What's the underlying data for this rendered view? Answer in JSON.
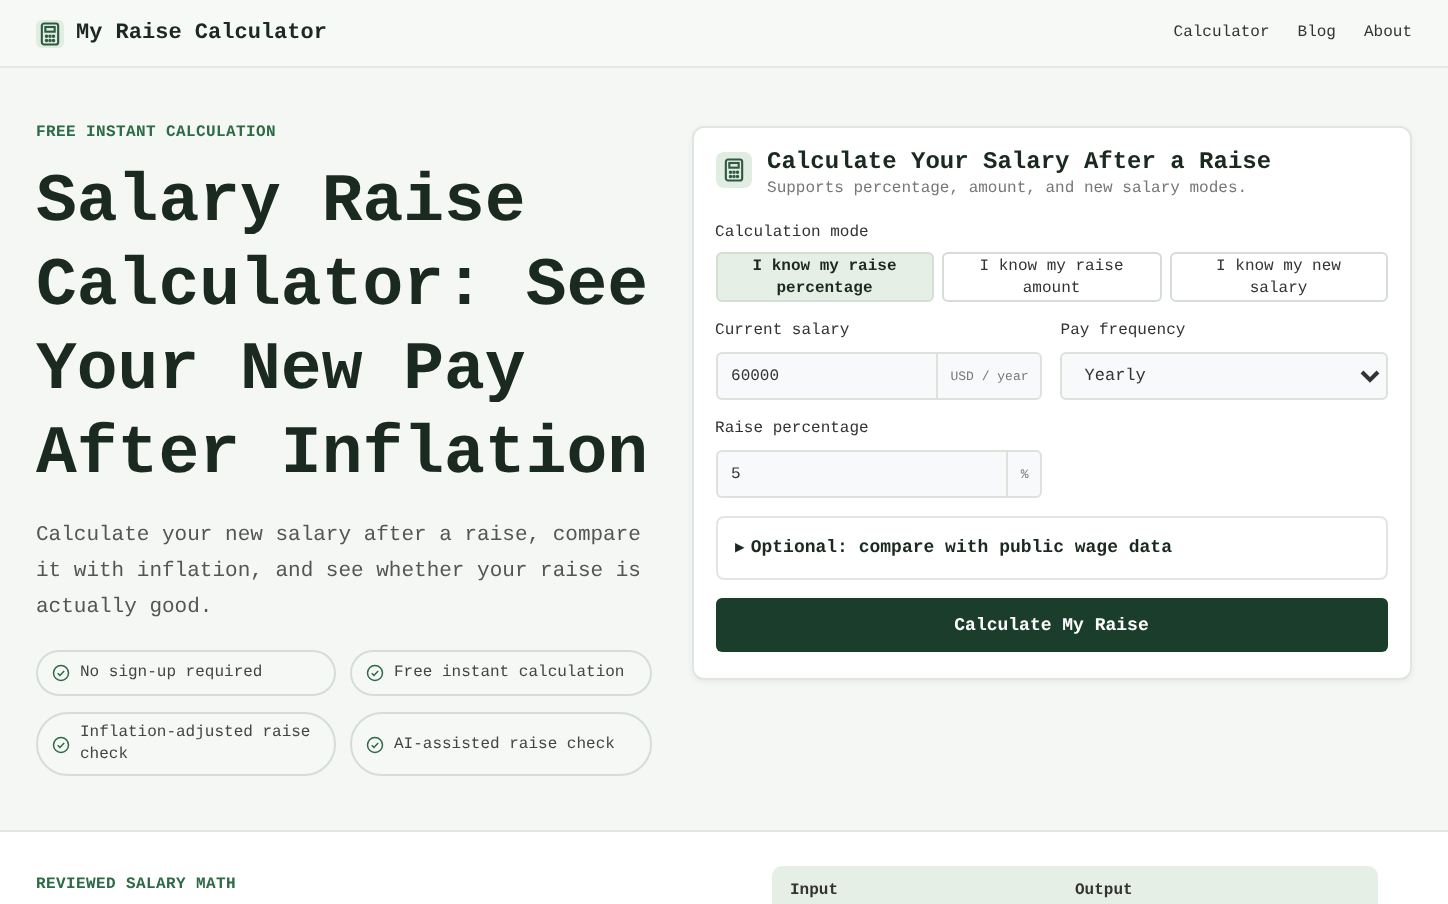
{
  "header": {
    "brand": "My Raise Calculator",
    "nav": [
      {
        "label": "Calculator"
      },
      {
        "label": "Blog"
      },
      {
        "label": "About"
      }
    ]
  },
  "hero": {
    "eyebrow": "FREE INSTANT CALCULATION",
    "title": "Salary Raise Calculator: See Your New Pay After Inflation",
    "lead": "Calculate your new salary after a raise, compare it with inflation, and see whether your raise is actually good.",
    "features": [
      {
        "label": "No sign-up required"
      },
      {
        "label": "Free instant calculation"
      },
      {
        "label": "Inflation-adjusted raise check"
      },
      {
        "label": "AI-assisted raise check"
      }
    ]
  },
  "calculator": {
    "title": "Calculate Your Salary After a Raise",
    "subtitle": "Supports percentage, amount, and new salary modes.",
    "mode_label": "Calculation mode",
    "modes": [
      {
        "label": "I know my raise percentage",
        "selected": true
      },
      {
        "label": "I know my raise amount",
        "selected": false
      },
      {
        "label": "I know my new salary",
        "selected": false
      }
    ],
    "salary": {
      "label": "Current salary",
      "value": "60000",
      "unit": "USD / year"
    },
    "frequency": {
      "label": "Pay frequency",
      "value": "Yearly"
    },
    "raise": {
      "label": "Raise percentage",
      "value": "5",
      "unit": "%"
    },
    "optional": {
      "marker": "▶",
      "label": "Optional: compare with public wage data",
      "expanded": false
    },
    "submit": "Calculate My Raise"
  },
  "reviewed": {
    "eyebrow": "REVIEWED SALARY MATH",
    "table": {
      "columns": [
        "Input",
        "Output"
      ]
    }
  }
}
